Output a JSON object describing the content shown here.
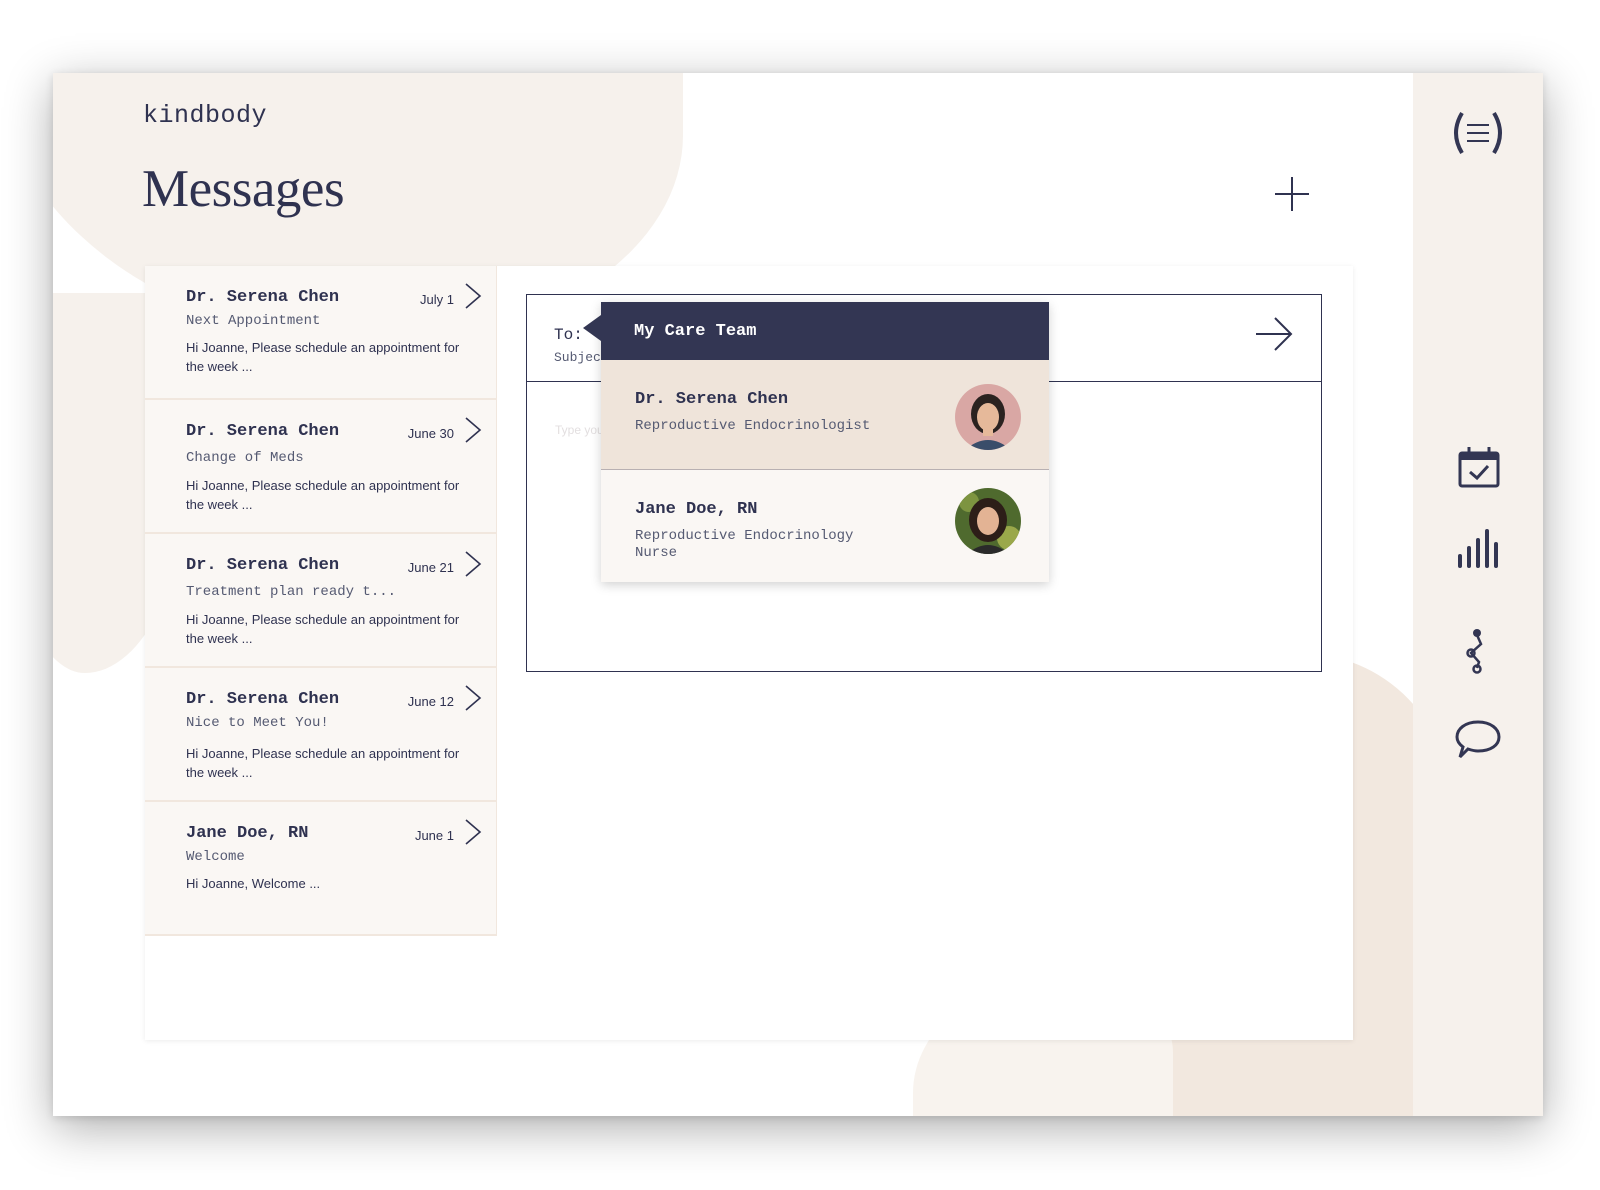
{
  "app": {
    "logo": "kindbody"
  },
  "page": {
    "title": "Messages"
  },
  "messages": [
    {
      "sender": "Dr. Serena Chen",
      "date": "July 1",
      "subject": "Next Appointment",
      "preview": "Hi Joanne, Please schedule an appointment for the week ..."
    },
    {
      "sender": "Dr. Serena Chen",
      "date": "June 30",
      "subject": "Change of Meds",
      "preview": "Hi Joanne, Please schedule an appointment for the week ..."
    },
    {
      "sender": "Dr. Serena Chen",
      "date": "June 21",
      "subject": "Treatment plan ready t...",
      "preview": "Hi Joanne, Please schedule an appointment for the week ..."
    },
    {
      "sender": "Dr. Serena Chen",
      "date": "June 12",
      "subject": "Nice to Meet You!",
      "preview": "Hi Joanne, Please schedule an appointment for the week ..."
    },
    {
      "sender": "Jane Doe, RN",
      "date": "June 1",
      "subject": "Welcome",
      "preview": "Hi Joanne, Welcome ..."
    }
  ],
  "compose": {
    "to_label": "To:",
    "subject_label": "Subject",
    "body_placeholder": "Type your"
  },
  "care_team": {
    "title": "My Care Team",
    "members": [
      {
        "name": "Dr. Serena Chen",
        "role": "Reproductive Endocrinologist",
        "selected": true
      },
      {
        "name": "Jane Doe, RN",
        "role": "Reproductive Endocrinology Nurse",
        "selected": false
      }
    ]
  },
  "sidebar": {
    "icons": [
      "menu-icon",
      "calendar-check-icon",
      "bar-chart-icon",
      "journey-icon",
      "chat-icon"
    ]
  },
  "colors": {
    "navy": "#333653",
    "cream": "#f6f1ec",
    "card": "#faf7f4",
    "selected": "#efe4da"
  }
}
